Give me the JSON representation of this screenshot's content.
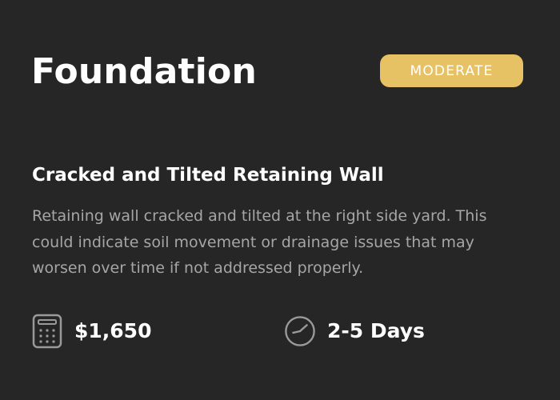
{
  "card": {
    "category": "Foundation",
    "severity": "MODERATE",
    "issue_title": "Cracked and Tilted Retaining Wall",
    "description": "Retaining wall cracked and tilted at the right side yard. This could indicate soil movement or drainage issues that may worsen over time if not addressed properly.",
    "cost": {
      "icon": "calculator-icon",
      "value": "$1,650"
    },
    "duration": {
      "icon": "clock-icon",
      "value": "2-5 Days"
    }
  },
  "colors": {
    "background": "#262626",
    "badge": "#e7c264",
    "text_primary": "#ffffff",
    "text_secondary": "#a6a6a6",
    "icon": "#9a9a9a"
  }
}
